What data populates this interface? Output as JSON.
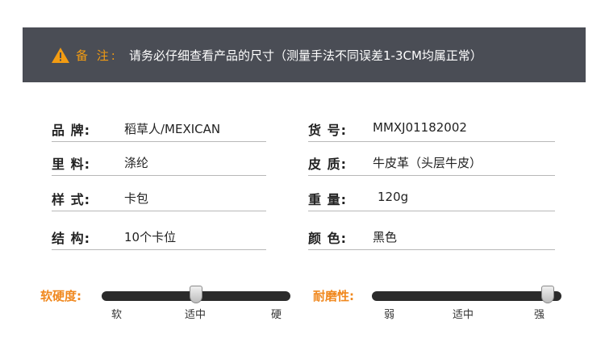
{
  "notice": {
    "label": "备 注:",
    "text": "请务必仔细查看产品的尺寸（测量手法不同误差1-3CM均属正常）",
    "accent": "#f39c12",
    "icon": "warning-icon"
  },
  "specs": {
    "left": [
      {
        "key": "品 牌:",
        "value": "稻草人/MEXICAN"
      },
      {
        "key": "里 料:",
        "value": "涤纶"
      },
      {
        "key": "样 式:",
        "value": "卡包"
      },
      {
        "key": "结 构:",
        "value": "10个卡位"
      }
    ],
    "right": [
      {
        "key": "货 号:",
        "value": "MMXJ01182002"
      },
      {
        "key": "皮 质:",
        "value": "牛皮革（头层牛皮）"
      },
      {
        "key": "重 量:",
        "value": "120g"
      },
      {
        "key": "颜 色:",
        "value": "黑色"
      }
    ]
  },
  "ratings": {
    "softness": {
      "title": "软硬度:",
      "labels": [
        "软",
        "适中",
        "硬"
      ],
      "level": 0.5
    },
    "durability": {
      "title": "耐磨性:",
      "labels": [
        "弱",
        "适中",
        "强"
      ],
      "level": 0.95
    }
  }
}
